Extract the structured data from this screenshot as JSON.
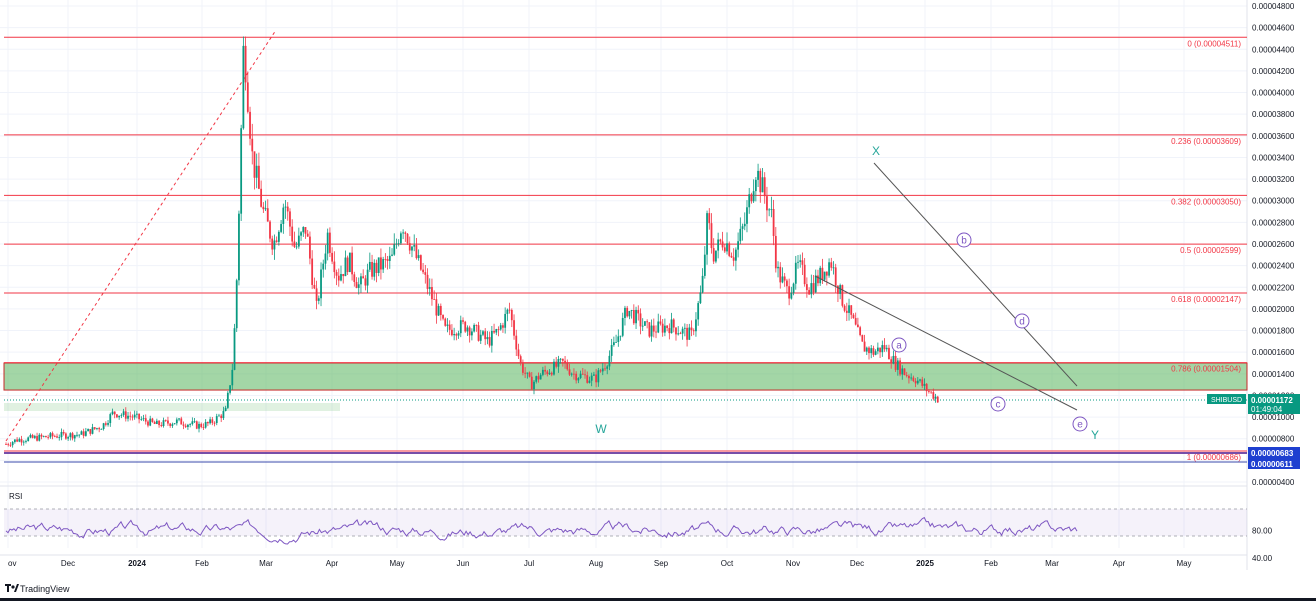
{
  "chart_data": {
    "type": "candlestick",
    "symbol": "SHIBUSD",
    "price_axis": {
      "ticks": [
        "0.00004800",
        "0.00004600",
        "0.00004400",
        "0.00004200",
        "0.00004000",
        "0.00003800",
        "0.00003600",
        "0.00003400",
        "0.00003200",
        "0.00003000",
        "0.00002800",
        "0.00002600",
        "0.00002400",
        "0.00002200",
        "0.00002000",
        "0.00001800",
        "0.00001600",
        "0.00001400",
        "0.00001200",
        "0.00001000",
        "0.00000800",
        "0.00000600",
        "0.00000400"
      ],
      "range": [
        4e-06,
        4.8e-05
      ]
    },
    "time_axis": {
      "labels": [
        "ov",
        "Dec",
        "2024",
        "Feb",
        "Mar",
        "Apr",
        "May",
        "Jun",
        "Jul",
        "Aug",
        "Sep",
        "Oct",
        "Nov",
        "Dec",
        "2025",
        "Feb",
        "Mar",
        "Apr",
        "May"
      ],
      "bold": [
        "2024",
        "2025"
      ]
    },
    "fib_levels": [
      {
        "label": "0 (0.00004511)",
        "value": 4.511e-05
      },
      {
        "label": "0.236 (0.00003609)",
        "value": 3.609e-05
      },
      {
        "label": "0.382 (0.00003050)",
        "value": 3.05e-05
      },
      {
        "label": "0.5 (0.00002599)",
        "value": 2.599e-05
      },
      {
        "label": "0.618 (0.00002147)",
        "value": 2.147e-05
      },
      {
        "label": "0.786 (0.00001504)",
        "value": 1.504e-05
      },
      {
        "label": "1 (0.00000686)",
        "value": 6.86e-06
      }
    ],
    "support_zone": [
      1.25e-05,
      1.5e-05
    ],
    "price_path": [
      [
        0,
        7.5e-06
      ],
      [
        0.01,
        7.9e-06
      ],
      [
        0.03,
        8.1e-06
      ],
      [
        0.05,
        8.3e-06
      ],
      [
        0.07,
        8.4e-06
      ],
      [
        0.09,
        9.2e-06
      ],
      [
        0.1,
        1.04e-05
      ],
      [
        0.12,
        1e-05
      ],
      [
        0.14,
        9.3e-06
      ],
      [
        0.16,
        9.6e-06
      ],
      [
        0.18,
        9.2e-06
      ],
      [
        0.19,
        9.4e-06
      ],
      [
        0.205,
        1.05e-05
      ],
      [
        0.212,
        1.5e-05
      ],
      [
        0.216,
        2.4e-05
      ],
      [
        0.222,
        4.5e-05
      ],
      [
        0.23,
        3.4e-05
      ],
      [
        0.24,
        2.9e-05
      ],
      [
        0.25,
        2.6e-05
      ],
      [
        0.26,
        3e-05
      ],
      [
        0.27,
        2.55e-05
      ],
      [
        0.28,
        2.75e-05
      ],
      [
        0.29,
        2e-05
      ],
      [
        0.3,
        2.7e-05
      ],
      [
        0.31,
        2.3e-05
      ],
      [
        0.32,
        2.45e-05
      ],
      [
        0.33,
        2.2e-05
      ],
      [
        0.34,
        2.35e-05
      ],
      [
        0.36,
        2.45e-05
      ],
      [
        0.37,
        2.8e-05
      ],
      [
        0.38,
        2.55e-05
      ],
      [
        0.39,
        2.3e-05
      ],
      [
        0.41,
        1.8e-05
      ],
      [
        0.43,
        1.85e-05
      ],
      [
        0.45,
        1.7e-05
      ],
      [
        0.46,
        1.8e-05
      ],
      [
        0.47,
        2e-05
      ],
      [
        0.48,
        1.5e-05
      ],
      [
        0.49,
        1.3e-05
      ],
      [
        0.5,
        1.4e-05
      ],
      [
        0.52,
        1.5e-05
      ],
      [
        0.53,
        1.4e-05
      ],
      [
        0.55,
        1.35e-05
      ],
      [
        0.56,
        1.5e-05
      ],
      [
        0.57,
        1.7e-05
      ],
      [
        0.58,
        2e-05
      ],
      [
        0.6,
        1.8e-05
      ],
      [
        0.62,
        1.85e-05
      ],
      [
        0.64,
        1.75e-05
      ],
      [
        0.65,
        2.2e-05
      ],
      [
        0.655,
        2.85e-05
      ],
      [
        0.66,
        2.5e-05
      ],
      [
        0.67,
        2.65e-05
      ],
      [
        0.68,
        2.5e-05
      ],
      [
        0.69,
        2.8e-05
      ],
      [
        0.7,
        3.3e-05
      ],
      [
        0.71,
        3e-05
      ],
      [
        0.715,
        2.85e-05
      ],
      [
        0.72,
        2.35e-05
      ],
      [
        0.73,
        2.15e-05
      ],
      [
        0.74,
        2.4e-05
      ],
      [
        0.75,
        2.2e-05
      ],
      [
        0.76,
        2.3e-05
      ],
      [
        0.77,
        2.45e-05
      ],
      [
        0.78,
        2.1e-05
      ],
      [
        0.79,
        1.9e-05
      ],
      [
        0.8,
        1.65e-05
      ],
      [
        0.81,
        1.6e-05
      ],
      [
        0.82,
        1.65e-05
      ],
      [
        0.83,
        1.5e-05
      ],
      [
        0.84,
        1.4e-05
      ],
      [
        0.85,
        1.35e-05
      ],
      [
        0.86,
        1.25e-05
      ],
      [
        0.87,
        1.17e-05
      ]
    ],
    "annotations": [
      {
        "label": "W",
        "kind": "plain",
        "color": "#26a69a"
      },
      {
        "label": "X",
        "kind": "plain",
        "color": "#26a69a"
      },
      {
        "label": "Y",
        "kind": "plain",
        "color": "#26a69a"
      },
      {
        "label": "a",
        "kind": "circle",
        "color": "#7e57c2"
      },
      {
        "label": "b",
        "kind": "circle",
        "color": "#7e57c2"
      },
      {
        "label": "c",
        "kind": "circle",
        "color": "#7e57c2"
      },
      {
        "label": "d",
        "kind": "circle",
        "color": "#7e57c2"
      },
      {
        "label": "e",
        "kind": "circle",
        "color": "#7e57c2"
      }
    ],
    "price_labels": [
      {
        "role": "last",
        "text": "0.00001172",
        "sub": "01:49:04",
        "color": "#089981"
      },
      {
        "role": "line-1",
        "text": "0.00000683",
        "color": "#1e3fd0"
      },
      {
        "role": "line-2",
        "text": "0.00000611",
        "color": "#1e3fd0"
      }
    ],
    "rsi": {
      "label": "RSI",
      "ticks": [
        "80.00",
        "40.00"
      ],
      "band": [
        30,
        70
      ]
    },
    "colors": {
      "up": "#089981",
      "down": "#f23645",
      "fib": "#f23645",
      "zone": "#66bb6a",
      "rsi": "#7e57c2",
      "trend": "#555555"
    }
  },
  "footer": {
    "brand": "TradingView"
  }
}
